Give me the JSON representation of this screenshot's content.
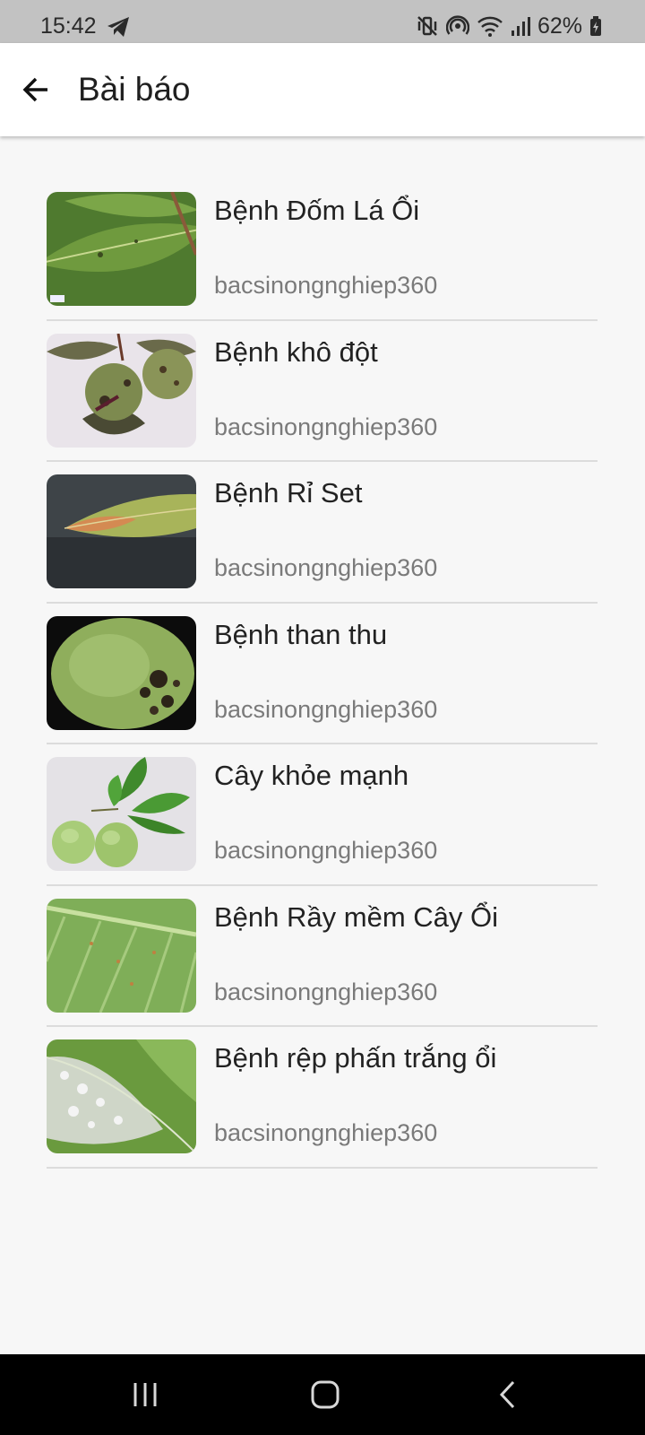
{
  "status_bar": {
    "time": "15:42",
    "battery": "62%",
    "icons": [
      "telegram-icon",
      "vibrate-mute-icon",
      "hotspot-icon",
      "wifi-icon",
      "signal-icon",
      "battery-icon"
    ]
  },
  "app_bar": {
    "back_icon": "arrow-left-icon",
    "title": "Bài báo"
  },
  "articles": [
    {
      "title": "Bệnh Đốm Lá Ổi",
      "source": "bacsinongnghiep360",
      "thumbnail": "leaf-spot-image"
    },
    {
      "title": "Bệnh khô đột",
      "source": "bacsinongnghiep360",
      "thumbnail": "dry-fruit-image"
    },
    {
      "title": "Bệnh Rỉ Set",
      "source": "bacsinongnghiep360",
      "thumbnail": "rust-leaf-image"
    },
    {
      "title": "Bệnh than thu",
      "source": "bacsinongnghiep360",
      "thumbnail": "anthracnose-fruit-image"
    },
    {
      "title": "Cây khỏe mạnh",
      "source": "bacsinongnghiep360",
      "thumbnail": "healthy-guava-image"
    },
    {
      "title": "Bệnh Rầy mềm Cây Ổi",
      "source": "bacsinongnghiep360",
      "thumbnail": "aphid-leaf-image"
    },
    {
      "title": "Bệnh rệp phấn trắng ổi",
      "source": "bacsinongnghiep360",
      "thumbnail": "whitefly-leaf-image"
    }
  ],
  "nav_bar": {
    "buttons": [
      "recent-apps-icon",
      "home-icon",
      "back-icon"
    ]
  },
  "colors": {
    "status_bar_bg": "#c2c2c2",
    "app_bar_bg": "#ffffff",
    "page_bg": "#f7f7f7",
    "divider": "#dcdcdc",
    "source_text": "#7a7a7a",
    "nav_bar_bg": "#000000"
  }
}
